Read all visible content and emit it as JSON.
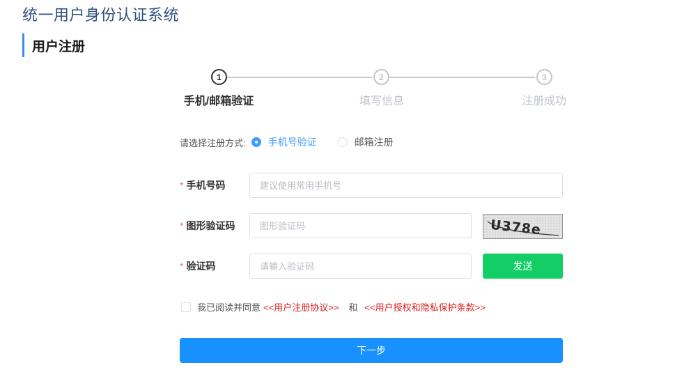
{
  "header": {
    "system_title": "统一用户身份认证系统",
    "section_title": "用户注册"
  },
  "steps": [
    {
      "number": "1",
      "label": "手机/邮箱验证",
      "active": true
    },
    {
      "number": "2",
      "label": "填写信息",
      "active": false
    },
    {
      "number": "3",
      "label": "注册成功",
      "active": false
    }
  ],
  "method": {
    "label": "请选择注册方式:",
    "options": [
      {
        "label": "手机号验证",
        "checked": true
      },
      {
        "label": "邮箱注册",
        "checked": false
      }
    ]
  },
  "form": {
    "required_mark": "*",
    "phone": {
      "label": "手机号码",
      "value": "",
      "placeholder": "建议使用常用手机号"
    },
    "captcha": {
      "label": "图形验证码",
      "value": "",
      "placeholder": "图形验证码",
      "image_text": "U378e"
    },
    "code": {
      "label": "验证码",
      "value": "",
      "placeholder": "请输入验证码"
    },
    "send_label": "发送"
  },
  "agreement": {
    "checked": false,
    "prefix": "我已阅读并同意",
    "link1": "<<用户注册协议>>",
    "and": "和",
    "link2": "<<用户授权和隐私保护条款>>"
  },
  "next_label": "下一步",
  "colors": {
    "primary": "#1890ff",
    "send": "#13ce66",
    "link": "#e01919",
    "radio": "#409eff",
    "title": "#2f4f7f"
  },
  "icons": {
    "radio_checked": "radio-checked-icon",
    "radio_unchecked": "radio-unchecked-icon",
    "checkbox": "checkbox-icon"
  }
}
